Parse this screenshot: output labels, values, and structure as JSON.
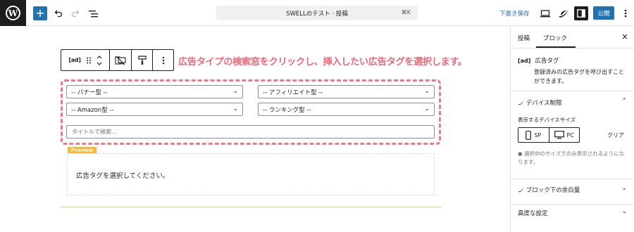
{
  "topbar": {
    "logo": "W",
    "add_label": "+",
    "doc_title": "SWELLのテスト · 投稿",
    "shortcut": "⌘K",
    "save_draft": "下書き保存",
    "publish": "公開"
  },
  "block_toolbar": {
    "ad_label": "[ad]"
  },
  "instruction": "広告タイプの検索窓をクリックし、挿入したい広告タグを選択します。",
  "filters": {
    "banner": "-- バナー型 --",
    "affiliate": "-- アフィリエイト型 --",
    "amazon": "-- Amazon型 --",
    "ranking": "-- ランキング型 --",
    "search_placeholder": "タイトルで検索..."
  },
  "preview": {
    "tag": "Preview",
    "message": "広告タグを選択してください。"
  },
  "sidebar": {
    "tabs": [
      "投稿",
      "ブロック"
    ],
    "close": "×",
    "block_icon": "[ad]",
    "block_name": "広告タグ",
    "block_desc": "登録済みの広告タグを呼び出すことができます。",
    "device_panel": "デバイス制限",
    "device_label": "表示するデバイスサイズ",
    "sp": "SP",
    "pc": "PC",
    "clear": "クリア",
    "device_note": "選択中のサイズでのみ表示されるようになります。",
    "margin_panel": "ブロック下の余白量",
    "advanced_panel": "高度な設定"
  },
  "colors": {
    "accent": "#2271b1",
    "instruction": "#ea6a7b",
    "dashed_border": "#ef7a84",
    "preview_tag": "#f7b733"
  }
}
